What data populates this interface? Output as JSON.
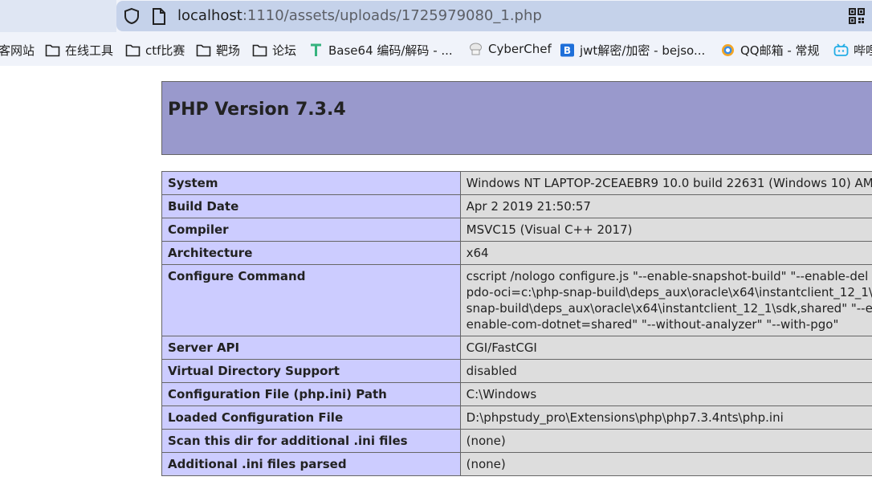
{
  "browser": {
    "url_host": "localhost",
    "url_rest": ":1110/assets/uploads/1725979080_1.php",
    "bookmarks": [
      {
        "label": "客网站",
        "icon": "none"
      },
      {
        "label": "在线工具",
        "icon": "folder-icon"
      },
      {
        "label": "ctf比赛",
        "icon": "folder-icon"
      },
      {
        "label": "靶场",
        "icon": "folder-icon"
      },
      {
        "label": "论坛",
        "icon": "folder-icon"
      },
      {
        "label": "Base64 编码/解码 - ...",
        "icon": "base64-tool-icon"
      },
      {
        "label": "CyberChef",
        "icon": "cyberchef-icon"
      },
      {
        "label": "jwt解密/加密 - bejso...",
        "icon": "bejson-icon"
      },
      {
        "label": "QQ邮箱 - 常规",
        "icon": "qq-mail-icon"
      },
      {
        "label": "哔哩",
        "icon": "bilibili-icon"
      }
    ]
  },
  "page": {
    "title": "PHP Version 7.3.4",
    "rows": [
      {
        "key": "System",
        "value": [
          "Windows NT LAPTOP-2CEAEBR9 10.0 build 22631 (Windows 10) AM"
        ]
      },
      {
        "key": "Build Date",
        "value": [
          "Apr 2 2019 21:50:57"
        ]
      },
      {
        "key": "Compiler",
        "value": [
          "MSVC15 (Visual C++ 2017)"
        ]
      },
      {
        "key": "Architecture",
        "value": [
          "x64"
        ]
      },
      {
        "key": "Configure Command",
        "value": [
          "cscript /nologo configure.js \"--enable-snapshot-build\" \"--enable-del",
          "pdo-oci=c:\\php-snap-build\\deps_aux\\oracle\\x64\\instantclient_12_1\\",
          "snap-build\\deps_aux\\oracle\\x64\\instantclient_12_1\\sdk,shared\" \"--er",
          "enable-com-dotnet=shared\" \"--without-analyzer\" \"--with-pgo\""
        ]
      },
      {
        "key": "Server API",
        "value": [
          "CGI/FastCGI"
        ]
      },
      {
        "key": "Virtual Directory Support",
        "value": [
          "disabled"
        ]
      },
      {
        "key": "Configuration File (php.ini) Path",
        "value": [
          "C:\\Windows"
        ]
      },
      {
        "key": "Loaded Configuration File",
        "value": [
          "D:\\phpstudy_pro\\Extensions\\php\\php7.3.4nts\\php.ini"
        ]
      },
      {
        "key": "Scan this dir for additional .ini files",
        "value": [
          "(none)"
        ]
      },
      {
        "key": "Additional .ini files parsed",
        "value": [
          "(none)"
        ]
      }
    ]
  },
  "colors": {
    "header_bg": "#9999cc",
    "key_bg": "#ccccff",
    "value_bg": "#dddddd"
  }
}
